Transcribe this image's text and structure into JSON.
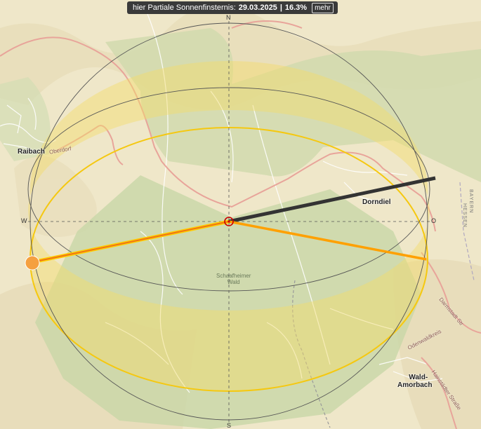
{
  "header": {
    "prefix": "hier Partiale Sonnenfinsternis:",
    "date": "29.03.2025",
    "separator": "|",
    "magnitude": "16.3%",
    "more_button": "mehr"
  },
  "compass": {
    "north": "N",
    "south": "S",
    "west": "W",
    "east": "O"
  },
  "places": {
    "raibach": "Raibach",
    "oberdorf": "Oberdorf",
    "dorndiel": "Dorndiel",
    "wald_amorbach_1": "Wald-",
    "wald_amorbach_2": "Amorbach"
  },
  "forest": {
    "line1": "Schaafheimer",
    "line2": "Wald"
  },
  "roads": {
    "odenwaldkreis": "Odenwaldkreis",
    "darmstadt": "Darmstadt Str",
    "hainstadt": "Hainstädter Straße"
  },
  "borders": {
    "bayern": "BAYERN",
    "hessen": "HESSEN"
  },
  "colors": {
    "sunrise_line": "#ffcc00",
    "sunset_line": "#ffa000",
    "sun_now": "#333333",
    "moon_line": "#e85020",
    "sun_marker": "#f5a040",
    "eclipse_band": "#f7e07a"
  },
  "icons": {
    "observer": "target-icon",
    "sun": "sun-icon"
  }
}
